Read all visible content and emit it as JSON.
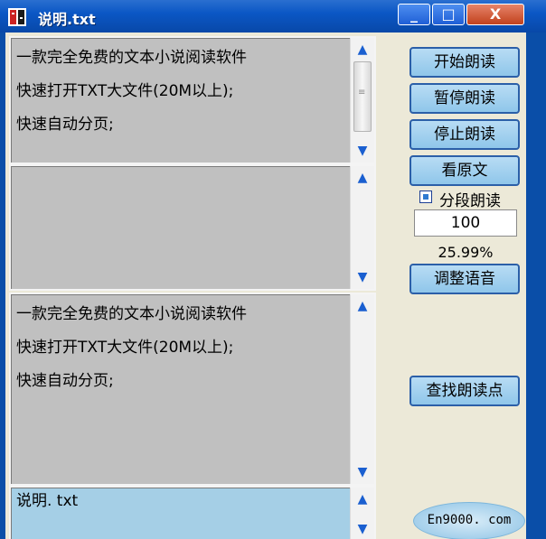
{
  "window": {
    "title": "说明.txt",
    "min_glyph": "_",
    "max_glyph": "□",
    "close_glyph": "X"
  },
  "panes": [
    {
      "lines": [
        "一款完全免费的文本小说阅读软件",
        "快速打开TXT大文件(20M以上);",
        "快速自动分页;"
      ]
    },
    {
      "lines": []
    },
    {
      "lines": [
        "一款完全免费的文本小说阅读软件",
        "快速打开TXT大文件(20M以上);",
        "快速自动分页;"
      ]
    },
    {
      "lines": [
        "说明. txt"
      ]
    }
  ],
  "scroll": {
    "up": "▲",
    "down": "▼",
    "grip": "≡"
  },
  "buttons": {
    "start": "开始朗读",
    "pause": "暂停朗读",
    "stop": "停止朗读",
    "view_original": "看原文",
    "adjust_voice": "调整语音",
    "find_point": "查找朗读点"
  },
  "segment": {
    "label": "分段朗读",
    "checked": true
  },
  "number": {
    "value": "100"
  },
  "progress": {
    "percent": "25.99%"
  },
  "logo": {
    "text": "En9000. com"
  },
  "colors": {
    "title_blue": "#0b57c5",
    "pane_gray": "#c0c0c0",
    "pane_blue": "#a5cfe6",
    "button_blue": "#9fd0f0",
    "button_border": "#2b5fa8"
  }
}
